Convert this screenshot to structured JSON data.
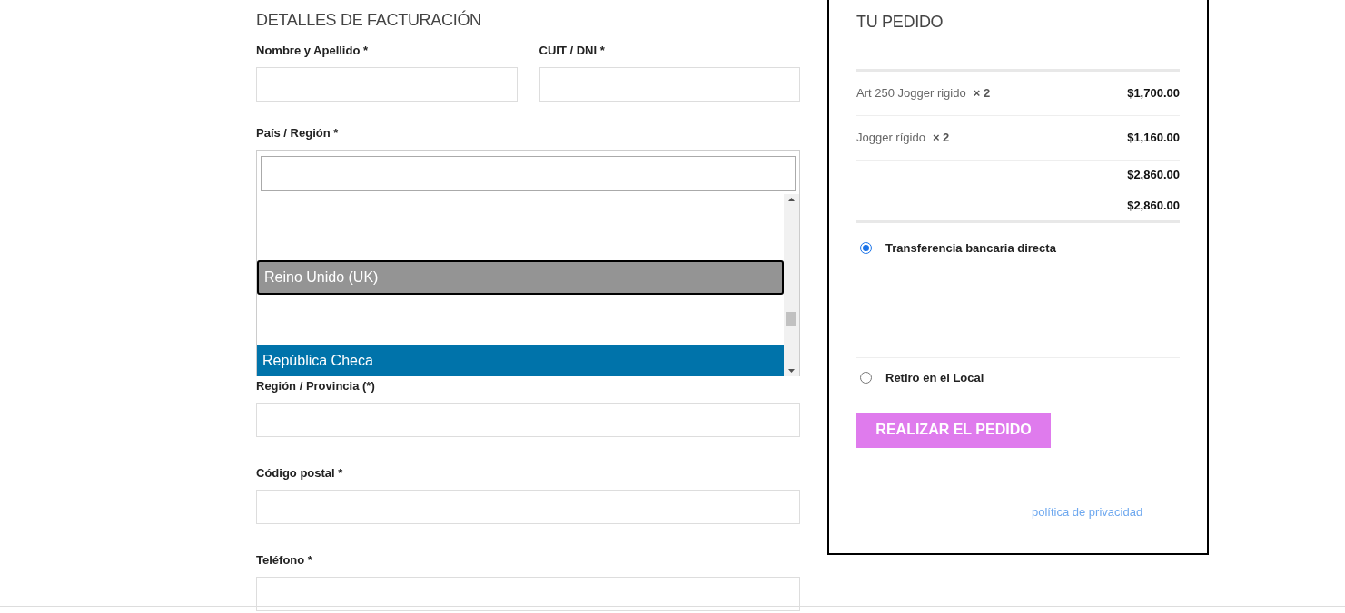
{
  "billing": {
    "title": "DETALLES DE FACTURACIÓN",
    "name_fields": [
      {
        "label": "Nombre y Apellido",
        "required_mark": "*"
      },
      {
        "label": "CUIT / DNI",
        "required_mark": "*"
      }
    ],
    "country": {
      "label": "País / Región",
      "required_mark": "*",
      "options": [
        {
          "label": "Reino Unido (UK)",
          "focused": true,
          "selected": false
        },
        {
          "label": "República Checa",
          "focused": false,
          "selected": true
        }
      ]
    },
    "fields": [
      {
        "label": "Región / Provincia (*)"
      },
      {
        "label": "Código postal",
        "required_mark": "*"
      },
      {
        "label": "Teléfono",
        "required_mark": "*"
      }
    ]
  },
  "order": {
    "title": "TU PEDIDO",
    "items": [
      {
        "name": "Art 250 Jogger rigido",
        "qty": "× 2",
        "price": "$1,700.00"
      },
      {
        "name": "Jogger rígido",
        "qty": "× 2",
        "price": "$1,160.00"
      }
    ],
    "totals": [
      "$2,860.00",
      "$2,860.00"
    ],
    "payment_methods": [
      {
        "label": "Transferencia bancaria directa",
        "selected": true
      },
      {
        "label": "Retiro en el Local",
        "selected": false
      }
    ],
    "button": "REALIZAR EL PEDIDO",
    "privacy_link": "política de privacidad"
  }
}
